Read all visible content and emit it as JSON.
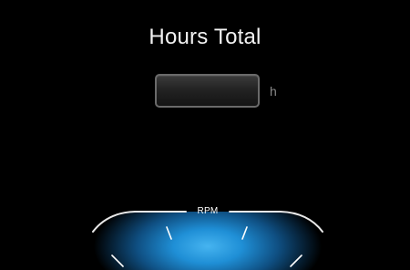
{
  "title": "Hours Total",
  "hours_field": {
    "value": "",
    "unit": "h"
  },
  "gauge": {
    "label": "RPM",
    "glow_color": "#1f8fd6",
    "ring_color": "#e8e8e8"
  },
  "colors": {
    "background": "#000000",
    "title_text": "#f2f2f2",
    "unit_text": "#8a8a8a"
  }
}
